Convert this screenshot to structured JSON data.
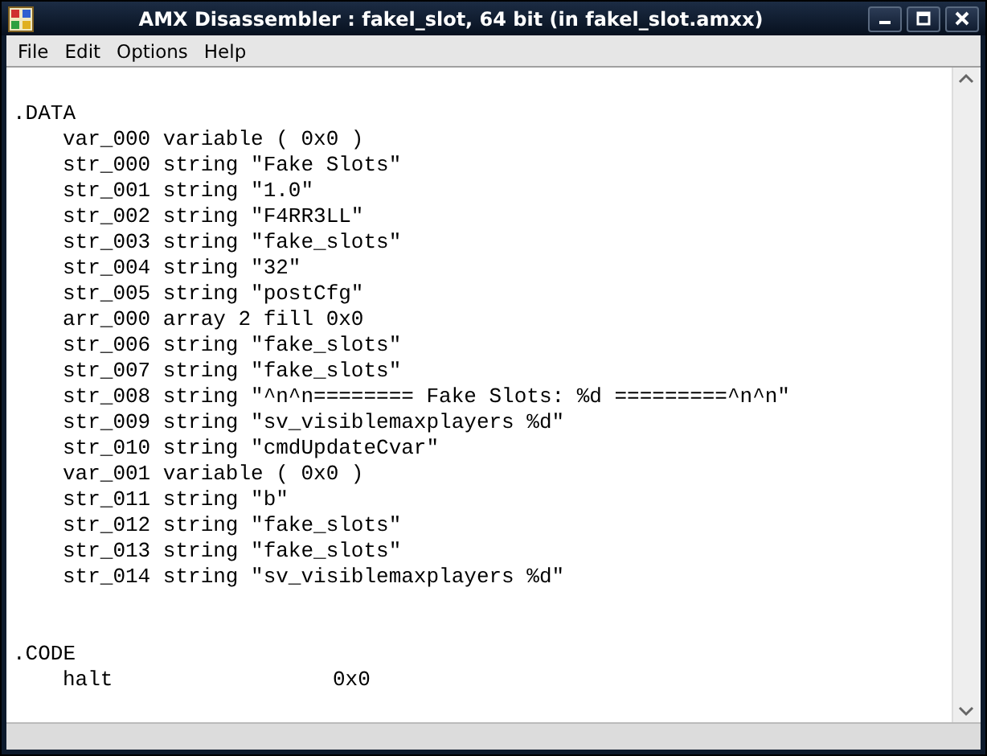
{
  "window": {
    "title": "AMX Disassembler : fakel_slot, 64 bit (in fakel_slot.amxx)"
  },
  "menu": [
    "File",
    "Edit",
    "Options",
    "Help"
  ],
  "sections": [
    {
      "kind": "data",
      "name": ".DATA",
      "lines": [
        "var_000 variable ( 0x0 )",
        "str_000 string \"Fake Slots\"",
        "str_001 string \"1.0\"",
        "str_002 string \"F4RR3LL\"",
        "str_003 string \"fake_slots\"",
        "str_004 string \"32\"",
        "str_005 string \"postCfg\"",
        "arr_000 array 2 fill 0x0",
        "str_006 string \"fake_slots\"",
        "str_007 string \"fake_slots\"",
        "str_008 string \"^n^n======== Fake Slots: %d =========^n^n\"",
        "str_009 string \"sv_visiblemaxplayers %d\"",
        "str_010 string \"cmdUpdateCvar\"",
        "var_001 variable ( 0x0 )",
        "str_011 string \"b\"",
        "str_012 string \"fake_slots\"",
        "str_013 string \"fake_slots\"",
        "str_014 string \"sv_visiblemaxplayers %d\""
      ]
    },
    {
      "kind": "code",
      "name": ".CODE",
      "instructions": [
        {
          "mnemonic": "halt",
          "operand": "0x0"
        }
      ]
    }
  ]
}
